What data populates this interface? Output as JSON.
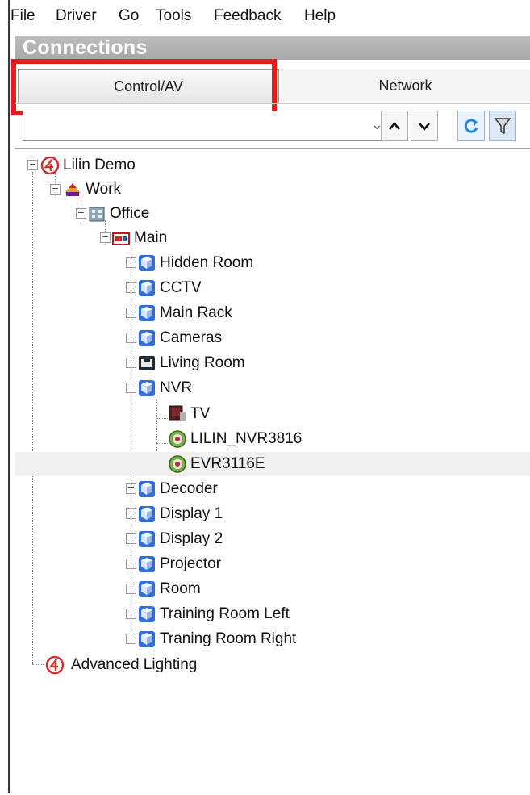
{
  "menu": [
    "File",
    "Driver",
    "Go",
    "Tools",
    "Feedback",
    "Help"
  ],
  "panel_title": "Connections",
  "tabs": {
    "control": "Control/AV",
    "network": "Network"
  },
  "filter": {
    "value": ""
  },
  "tree": {
    "root": "Lilin Demo",
    "work": "Work",
    "office": "Office",
    "main": "Main",
    "children": [
      "Hidden Room",
      "CCTV",
      "Main Rack",
      "Cameras",
      "Living Room",
      "NVR"
    ],
    "nvr_children": [
      "TV",
      "LILIN_NVR3816",
      "EVR3116E"
    ],
    "after": [
      "Decoder",
      "Display 1",
      "Display 2",
      "Projector",
      "Room",
      "Training Room Left",
      "Traning Room Right"
    ],
    "root2": "Advanced Lighting"
  }
}
